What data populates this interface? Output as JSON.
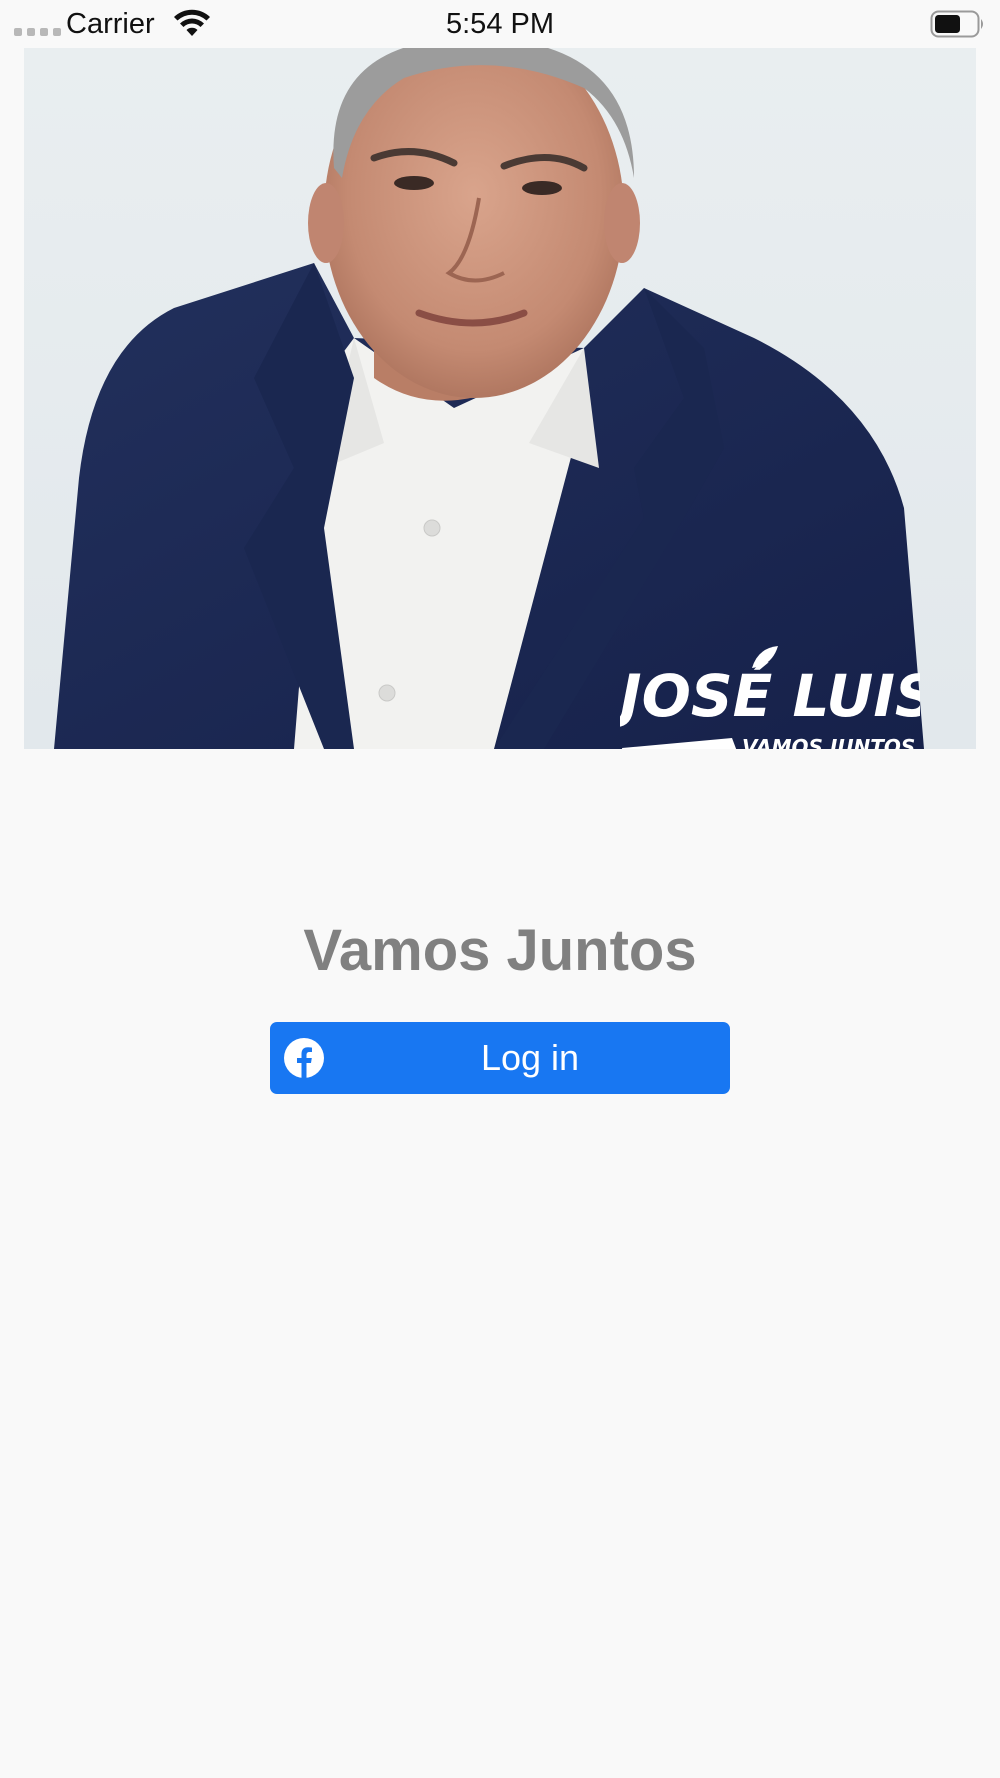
{
  "status_bar": {
    "carrier": "Carrier",
    "time": "5:54 PM",
    "signal_icon": "signal-dots-icon",
    "wifi_icon": "wifi-icon",
    "battery_icon": "battery-icon"
  },
  "hero": {
    "logo_name": "JOSÉ LUIS",
    "logo_tagline": "VAMOS JUNTOS"
  },
  "main": {
    "title": "Vamos Juntos",
    "login_label": "Log in",
    "login_icon": "facebook-icon"
  },
  "colors": {
    "background": "#f9f9f9",
    "title": "#808080",
    "button": "#1877f2",
    "button_text": "#ffffff",
    "jacket": "#1b2a55"
  }
}
